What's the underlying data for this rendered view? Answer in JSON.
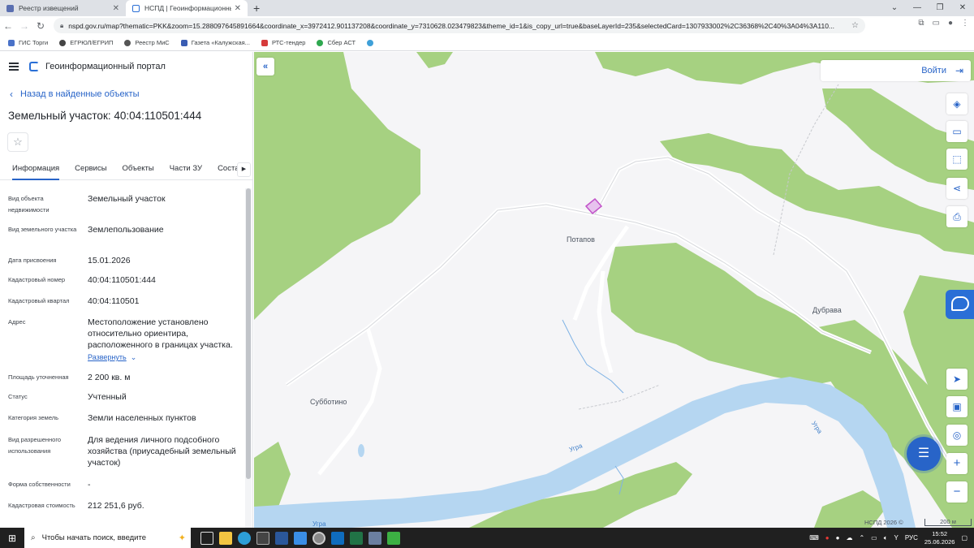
{
  "browser": {
    "tabs": [
      {
        "title": "Реестр извещений",
        "active": false
      },
      {
        "title": "НСПД | Геоинформационный п",
        "active": true
      }
    ],
    "url": "nspd.gov.ru/map?thematic=PKK&zoom=15.288097645891664&coordinate_x=3972412.901137208&coordinate_y=7310628.023479823&theme_id=1&is_copy_url=true&baseLayerId=235&selectedCard=1307933002%2C36368%2C40%3A04%3A110...",
    "bookmarks": [
      "ГИС Торги",
      "ЕГРЮЛ/ЕГРИП",
      "Реестр МиС",
      "Газета «Калужская...",
      "РТС-тендер",
      "Сбер АСТ"
    ]
  },
  "panel": {
    "portal_name": "Геоинформационный портал",
    "back_label": "Назад в найденные объекты",
    "title": "Земельный участок: 40:04:110501:444",
    "tabs": [
      "Информация",
      "Сервисы",
      "Объекты",
      "Части ЗУ",
      "Состав"
    ],
    "attributes": [
      {
        "key": "Вид объекта недвижимости",
        "value": "Земельный участок"
      },
      {
        "key": "Вид земельного участка",
        "value": "Землепользование"
      },
      {
        "key": "Дата присвоения",
        "value": "15.01.2026"
      },
      {
        "key": "Кадастровый номер",
        "value": "40:04:110501:444"
      },
      {
        "key": "Кадастровый квартал",
        "value": "40:04:110501"
      },
      {
        "key": "Адрес",
        "value": "Местоположение установлено относительно ориентира, расположенного в границах участка."
      },
      {
        "key": "Площадь уточненная",
        "value": "2 200 кв. м"
      },
      {
        "key": "Статус",
        "value": "Учтенный"
      },
      {
        "key": "Категория земель",
        "value": "Земли населенных пунктов"
      },
      {
        "key": "Вид разрешенного использования",
        "value": "Для ведения личного подсобного хозяйства (приусадебный земельный участок)"
      },
      {
        "key": "Форма собственности",
        "value": "-"
      },
      {
        "key": "Кадастровая стоимость",
        "value": "212 251,6 руб."
      }
    ],
    "expand_label": "Развернуть"
  },
  "map": {
    "login_label": "Войти",
    "places": [
      "Потапов",
      "Дубрава",
      "Субботино"
    ],
    "rivers": [
      "Угра",
      "Угра",
      "Угра"
    ],
    "copyright": "НСПД 2026 ©",
    "scale": "200 м"
  },
  "taskbar": {
    "search_placeholder": "Чтобы начать поиск, введите",
    "lang": "РУС",
    "time": "15:52",
    "date": "25.06.2026"
  },
  "colors": {
    "accent": "#2864c8",
    "forest": "#a6d181",
    "river": "#b5d6f1",
    "parcel": "#c252c9"
  }
}
